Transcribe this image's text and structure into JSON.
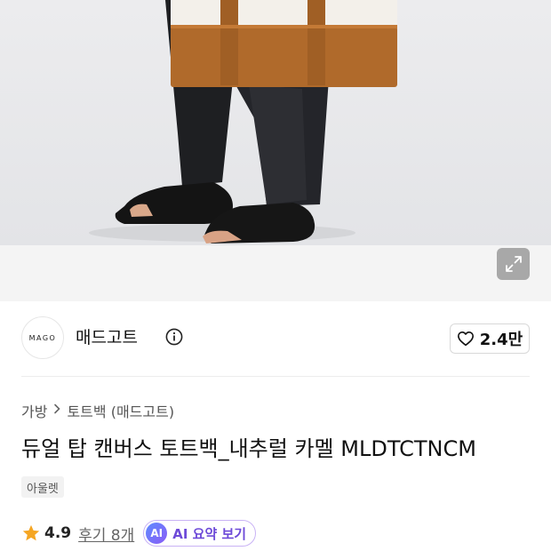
{
  "hero": {
    "image_alt": "model carrying canvas tote bag",
    "expand_icon": "expand-icon"
  },
  "brand": {
    "logo_text": "MAGO",
    "name": "매드고트",
    "info_icon": "info-icon",
    "like_icon": "heart-icon",
    "like_count": "2.4만"
  },
  "breadcrumb": {
    "items": [
      "가방",
      "토트백 (매드고트)"
    ],
    "separator_icon": "chevron-right-icon"
  },
  "product": {
    "title": "듀얼 탑 캔버스 토트백_내추럴 카멜 MLDTCTNCM",
    "badge": "아울렛"
  },
  "rating": {
    "star_icon": "star-icon",
    "star_color": "#f5a623",
    "value": "4.9",
    "review_label": "후기 8개",
    "ai_icon_text": "AI",
    "ai_label": "AI 요약 보기",
    "ai_color": "#6d4ad8"
  }
}
